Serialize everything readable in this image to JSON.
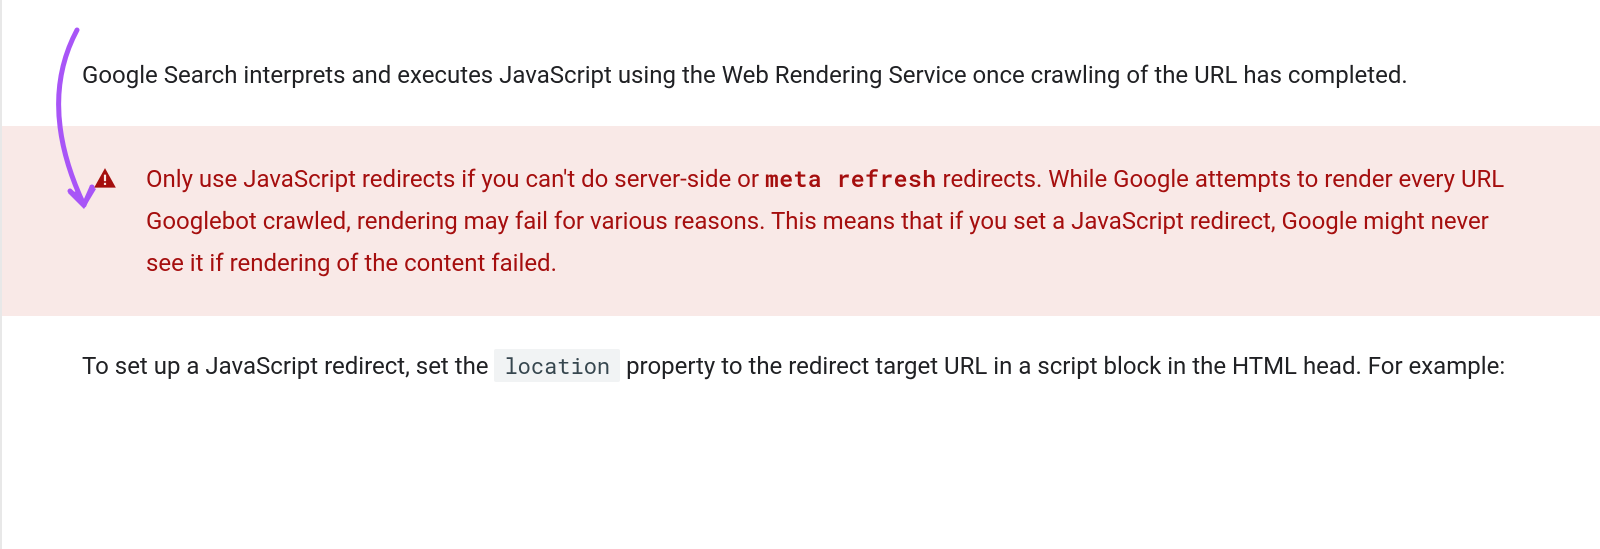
{
  "paragraph1": "Google Search interprets and executes JavaScript using the Web Rendering Service once crawling of the URL has completed.",
  "warning": {
    "text_before_code": "Only use JavaScript redirects if you can't do server-side or ",
    "code": "meta refresh",
    "text_after_code": " redirects. While Google attempts to render every URL Googlebot crawled, rendering may fail for various reasons. This means that if you set a JavaScript redirect, Google might never see it if rendering of the content failed."
  },
  "paragraph2": {
    "before": "To set up a JavaScript redirect, set the ",
    "code": "location",
    "after": " property to the redirect target URL in a script block in the HTML head. For example:"
  },
  "colors": {
    "warning_bg": "#f9e9e7",
    "warning_text": "#a50e0e",
    "code_chip_bg": "#f1f3f4",
    "arrow": "#a855f7"
  }
}
